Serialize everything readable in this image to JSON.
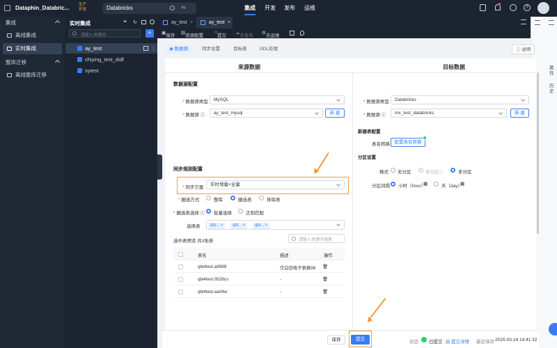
{
  "topbar": {
    "app_title": "Dataphin_Databric...",
    "env_badge": "生产\n开发",
    "context": "Databricks",
    "nav": [
      "集成",
      "开发",
      "发布",
      "运维"
    ],
    "nav_active": "集成"
  },
  "sidebar": {
    "group1": "集成",
    "items": [
      "离线集成",
      "实时集成"
    ],
    "group2": "整库迁移",
    "items2": [
      "离线整库迁移"
    ],
    "active": "实时集成"
  },
  "explorer": {
    "title": "实时集成",
    "search_placeholder": "请输入关键词",
    "add_label": "+",
    "items": [
      "ay_test",
      "chiying_test_didf",
      "sytest"
    ],
    "active": "ay_test"
  },
  "tabs": [
    "ay_test",
    "ay_test"
  ],
  "toolbar": [
    "保存",
    "资源配置",
    "提交",
    "去发布",
    "去运维"
  ],
  "steps": [
    "数据源",
    "同步设置",
    "目标表",
    "DDL处理"
  ],
  "help_button": "说明",
  "right_rail": [
    "属性",
    "历史"
  ],
  "source": {
    "heading": "来源数据",
    "section": "数据源配置",
    "type_label": "数据源类型",
    "type_value": "MySQL",
    "ds_label": "数据源",
    "ds_value": "ay_test_mysql",
    "new_button": "新 建"
  },
  "target": {
    "heading": "目标数据",
    "type_label": "数据源类型",
    "type_value": "Databricks",
    "ds_label": "数据源",
    "ds_value": "mx_test_databricks",
    "new_button": "新 建",
    "new_table_section": "新建表配置",
    "name_convert_label": "表名转换",
    "name_convert_button": "配置表名转换",
    "partition_section": "分区设置",
    "format_label": "格式",
    "format_options": [
      "无分区",
      "单分区",
      "多分区"
    ],
    "interval_label": "分区间隔",
    "interval_options": [
      "小时（hour）",
      "天（day）"
    ]
  },
  "sync_rules": {
    "section": "同步规则配置",
    "plan_label": "同步方案",
    "plan_value": "实时增量+全量",
    "method_label": "圈选方式",
    "method_options": [
      "整库",
      "圈选表",
      "排除表"
    ],
    "table_select_label": "圈选表选择",
    "table_select_options": [
      "批量选择",
      "正则匹配"
    ],
    "choose_label": "选择表",
    "chosen_tags": [
      "qbi...",
      "qbi...",
      "qbi..."
    ],
    "preview_label": "选中表预览 共3张表",
    "preview_search_placeholder": "请输入关键字搜索",
    "table_headers": [
      "表名",
      "描述",
      "操作"
    ],
    "rows": [
      {
        "name": "qbi4test.a9999",
        "desc": "空白旧电子表格98"
      },
      {
        "name": "qbi4test.0528cs",
        "desc": "-"
      },
      {
        "name": "qbi4test.aa04w",
        "desc": "-"
      }
    ]
  },
  "footer": {
    "save": "保存",
    "submit": "提交",
    "status_label": "状态",
    "status_value": "已提交",
    "submit_detail": "提交详情",
    "last_saved_label": "最近保存",
    "last_saved_value": "2025-03-24 14:41:32"
  },
  "colors": {
    "accent": "#3b7cf5",
    "highlight": "#f39a3b",
    "dark_bg": "#1b2430"
  }
}
